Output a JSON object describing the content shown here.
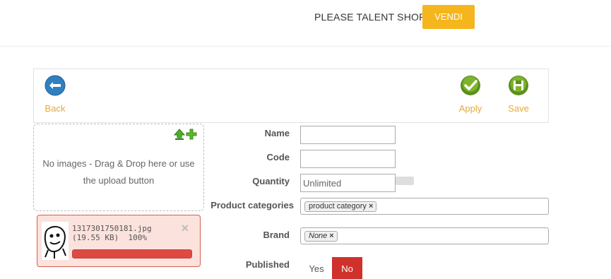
{
  "header": {
    "shop_name": "PLEASE TALENT SHOP",
    "vendi_label": "VENDI",
    "vendi_color": "#f5b51c"
  },
  "toolbar": {
    "back_label": "Back",
    "apply_label": "Apply",
    "save_label": "Save"
  },
  "images": {
    "dropzone_text": "No images - Drag & Drop here or use the upload button",
    "upload": {
      "file_name": "1317301750181.jpg",
      "file_size": "(19.55 KB)",
      "progress_text": "100%",
      "progress": 1.0
    }
  },
  "form": {
    "name_label": "Name",
    "name_value": "",
    "code_label": "Code",
    "code_value": "",
    "quantity_label": "Quantity",
    "quantity_placeholder": "Unlimited",
    "categories_label": "Product categories",
    "category_tag": "product category",
    "brand_label": "Brand",
    "brand_tag": "None",
    "published_label": "Published",
    "published_yes": "Yes",
    "published_no": "No",
    "published_selected": "No",
    "no_color": "#d0312a"
  }
}
